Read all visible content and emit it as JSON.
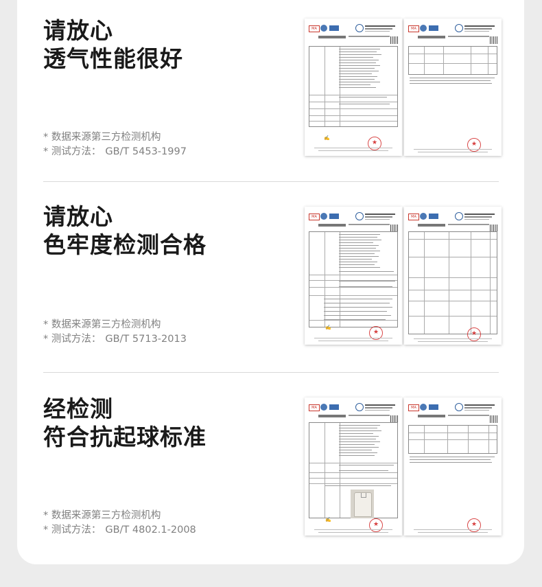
{
  "sections": [
    {
      "title_line1": "请放心",
      "title_line2": "透气性能很好",
      "note_source": "* 数据来源第三方检测机构",
      "note_method_label": "* 测试方法：",
      "note_method_value": "GB/T 5453-1997"
    },
    {
      "title_line1": "请放心",
      "title_line2": "色牢度检测合格",
      "note_source": "* 数据来源第三方检测机构",
      "note_method_label": "* 测试方法：",
      "note_method_value": "GB/T 5713-2013"
    },
    {
      "title_line1": "经检测",
      "title_line2": "符合抗起球标准",
      "note_source": "* 数据来源第三方检测机构",
      "note_method_label": "* 测试方法：",
      "note_method_value": "GB/T 4802.1-2008"
    }
  ],
  "icons": {
    "ma_badge": "ma-badge-icon",
    "cnas_badge": "cnas-badge-icon",
    "qr": "qr-code-icon",
    "stamp": "red-seal-stamp-icon",
    "shirt": "shirt-photo-icon"
  },
  "colors": {
    "title": "#1a1a1a",
    "note": "#808080",
    "stamp": "#d22828",
    "background": "#ececec",
    "card": "#ffffff"
  }
}
